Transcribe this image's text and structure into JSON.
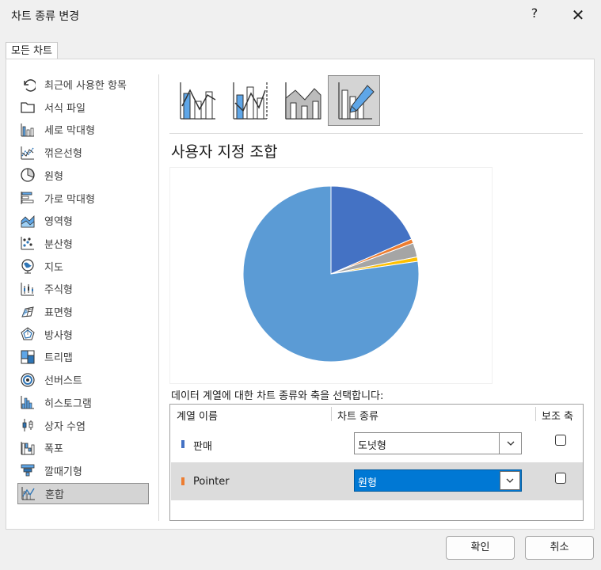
{
  "window": {
    "title": "차트 종류 변경",
    "help": "?",
    "close": "✕"
  },
  "tab": {
    "label": "모든 차트"
  },
  "chart_types": [
    {
      "label": "최근에 사용한 항목",
      "icon": "recent-icon"
    },
    {
      "label": "서식 파일",
      "icon": "folder-icon"
    },
    {
      "label": "세로 막대형",
      "icon": "column-chart-icon"
    },
    {
      "label": "꺾은선형",
      "icon": "line-chart-icon"
    },
    {
      "label": "원형",
      "icon": "pie-chart-icon"
    },
    {
      "label": "가로 막대형",
      "icon": "bar-chart-icon"
    },
    {
      "label": "영역형",
      "icon": "area-chart-icon"
    },
    {
      "label": "분산형",
      "icon": "scatter-chart-icon"
    },
    {
      "label": "지도",
      "icon": "map-chart-icon"
    },
    {
      "label": "주식형",
      "icon": "stock-chart-icon"
    },
    {
      "label": "표면형",
      "icon": "surface-chart-icon"
    },
    {
      "label": "방사형",
      "icon": "radar-chart-icon"
    },
    {
      "label": "트리맵",
      "icon": "treemap-chart-icon"
    },
    {
      "label": "선버스트",
      "icon": "sunburst-chart-icon"
    },
    {
      "label": "히스토그램",
      "icon": "histogram-chart-icon"
    },
    {
      "label": "상자 수염",
      "icon": "box-whisker-chart-icon"
    },
    {
      "label": "폭포",
      "icon": "waterfall-chart-icon"
    },
    {
      "label": "깔때기형",
      "icon": "funnel-chart-icon"
    },
    {
      "label": "혼합",
      "icon": "combo-chart-icon",
      "selected": true
    }
  ],
  "subtypes": [
    {
      "icon": "clustered-column-line-icon"
    },
    {
      "icon": "clustered-column-line-secondary-icon"
    },
    {
      "icon": "stacked-area-column-icon"
    },
    {
      "icon": "custom-combination-icon",
      "selected": true
    }
  ],
  "heading": "사용자 지정 조합",
  "chart_data": {
    "type": "pie",
    "values": [
      18.5,
      0.8,
      2.6,
      0.8,
      77.3
    ],
    "colors": [
      "#4472c4",
      "#ed7d31",
      "#a5a5a5",
      "#ffc000",
      "#5b9bd5"
    ]
  },
  "instruction": "데이터 계열에 대한 차트 종류와 축을 선택합니다:",
  "series_table": {
    "headers": {
      "name": "계열 이름",
      "type": "차트 종류",
      "axis": "보조 축"
    },
    "rows": [
      {
        "name": "판매",
        "chart_type": "도넛형",
        "color": "#4472c4",
        "secondary": false
      },
      {
        "name": "Pointer",
        "chart_type": "원형",
        "color": "#ed7d31",
        "secondary": false
      }
    ]
  },
  "buttons": {
    "ok": "확인",
    "cancel": "취소"
  }
}
